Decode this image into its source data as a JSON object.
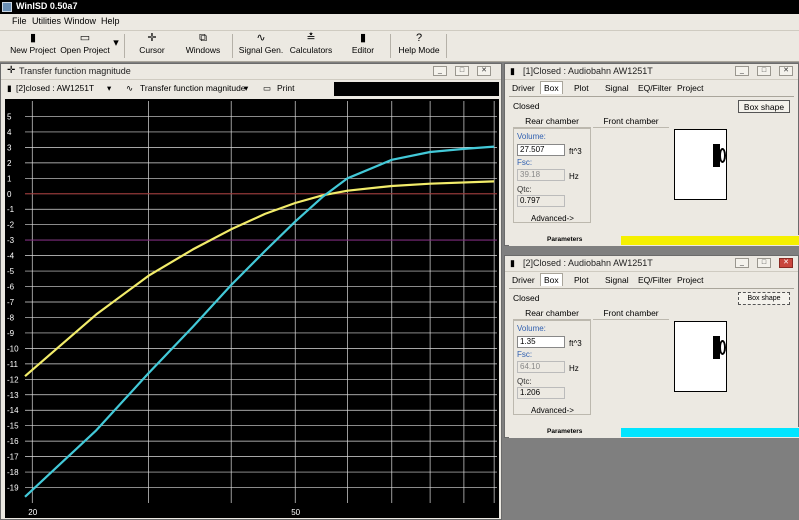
{
  "app": {
    "title": "WinISD 0.50a7"
  },
  "menu": [
    "File",
    "Utilities",
    "Window",
    "Help"
  ],
  "toolbar": [
    {
      "glyph": "▮",
      "label": "New Project"
    },
    {
      "glyph": "▭",
      "label": "Open Project"
    },
    {
      "glyph": "▾",
      "label": ""
    },
    {
      "glyph": "✛",
      "label": "Cursor"
    },
    {
      "glyph": "⧉",
      "label": "Windows"
    },
    {
      "glyph": "∿",
      "label": "Signal Gen."
    },
    {
      "glyph": "≛",
      "label": "Calculators"
    },
    {
      "glyph": "▮",
      "label": "Editor"
    },
    {
      "glyph": "?",
      "label": "Help Mode"
    }
  ],
  "graph_window": {
    "title": "Transfer function magnitude",
    "project_select": "[2]closed : AW1251T",
    "graph_select": "Transfer function magnitude",
    "print_label": "Print"
  },
  "chart_data": {
    "type": "line",
    "title": "",
    "xlabel": "",
    "ylabel": "",
    "x_scale": "log",
    "xlim": [
      19.5,
      101
    ],
    "ylim": [
      -20,
      6
    ],
    "yticks": [
      5,
      4,
      3,
      2,
      1,
      0,
      -1,
      -2,
      -3,
      -4,
      -5,
      -6,
      -7,
      -8,
      -9,
      -10,
      -11,
      -12,
      -13,
      -14,
      -15,
      -16,
      -17,
      -18,
      -19
    ],
    "xtick_labels": [
      {
        "x": 20,
        "label": "20"
      },
      {
        "x": 50,
        "label": "50"
      }
    ],
    "x_gridlines": [
      20,
      30,
      40,
      50,
      60,
      70,
      80,
      90,
      100
    ],
    "reference_lines": [
      {
        "y": 0,
        "color": "#9a2f2f"
      },
      {
        "y": -3,
        "color": "#7e2a7e"
      }
    ],
    "grid": true,
    "background": "#000000",
    "series": [
      {
        "color": "#f2ec6a",
        "x": [
          19.5,
          25,
          30,
          35,
          40,
          45,
          50,
          55,
          60,
          70,
          80,
          100
        ],
        "y": [
          -11.8,
          -7.8,
          -5.3,
          -3.6,
          -2.3,
          -1.3,
          -0.6,
          -0.1,
          0.2,
          0.5,
          0.65,
          0.8
        ]
      },
      {
        "color": "#43c9d8",
        "x": [
          19.5,
          25,
          30,
          35,
          40,
          45,
          50,
          55,
          60,
          70,
          80,
          90,
          100
        ],
        "y": [
          -19.6,
          -15.3,
          -11.6,
          -8.6,
          -5.9,
          -3.7,
          -1.8,
          -0.2,
          1.0,
          2.2,
          2.7,
          2.9,
          3.05
        ]
      }
    ]
  },
  "panels": [
    {
      "title": "[1]Closed : Audiobahn AW1251T",
      "tabs": [
        "Driver",
        "Box",
        "Plot",
        "Signal",
        "EQ/Filter",
        "Project"
      ],
      "active_tab": "Box",
      "box_type": "Closed",
      "box_shape_label": "Box shape",
      "rear_chamber": "Rear chamber",
      "front_chamber": "Front chamber",
      "volume_label": "Volume:",
      "volume_value": "27.507",
      "volume_unit": "ft^3",
      "fsc_label": "Fsc:",
      "fsc_value": "39.18",
      "fsc_unit": "Hz",
      "qtc_label": "Qtc:",
      "qtc_value": "0.797",
      "advanced_label": "Advanced->",
      "parameters_label": "Parameters",
      "series_color": "#f5f000"
    },
    {
      "title": "[2]Closed : Audiobahn AW1251T",
      "tabs": [
        "Driver",
        "Box",
        "Plot",
        "Signal",
        "EQ/Filter",
        "Project"
      ],
      "active_tab": "Box",
      "box_type": "Closed",
      "box_shape_label": "Box shape",
      "rear_chamber": "Rear chamber",
      "front_chamber": "Front chamber",
      "volume_label": "Volume:",
      "volume_value": "1.35",
      "volume_unit": "ft^3",
      "fsc_label": "Fsc:",
      "fsc_value": "64.10",
      "fsc_unit": "Hz",
      "qtc_label": "Qtc:",
      "qtc_value": "1.206",
      "advanced_label": "Advanced->",
      "parameters_label": "Parameters",
      "series_color": "#00e5ff"
    }
  ]
}
